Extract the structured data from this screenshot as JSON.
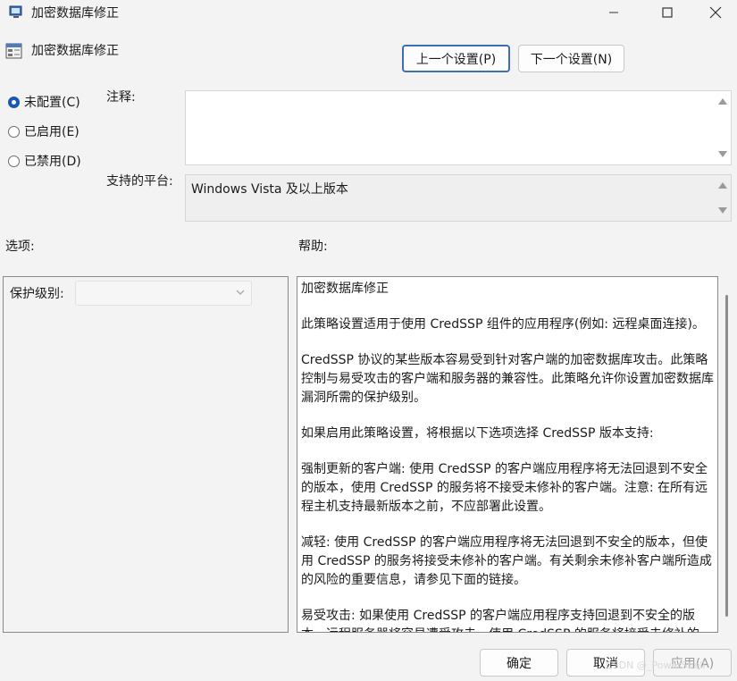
{
  "window": {
    "title": "加密数据库修正",
    "controls": {
      "minimize": "—",
      "maximize": "☐",
      "close": "✕"
    }
  },
  "header": {
    "policy_title": "加密数据库修正",
    "prev_label": "上一个设置(P)",
    "next_label": "下一个设置(N)"
  },
  "state": {
    "options": [
      {
        "label": "未配置(C)",
        "checked": true
      },
      {
        "label": "已启用(E)",
        "checked": false
      },
      {
        "label": "已禁用(D)",
        "checked": false
      }
    ]
  },
  "comment": {
    "label": "注释:",
    "value": ""
  },
  "platform": {
    "label": "支持的平台:",
    "value": "Windows Vista 及以上版本"
  },
  "options_section": {
    "label": "选项:",
    "protection_label": "保护级别:",
    "protection_value": ""
  },
  "help_section": {
    "label": "帮助:",
    "paragraphs": [
      "加密数据库修正",
      "此策略设置适用于使用 CredSSP 组件的应用程序(例如: 远程桌面连接)。",
      "CredSSP 协议的某些版本容易受到针对客户端的加密数据库攻击。此策略控制与易受攻击的客户端和服务器的兼容性。此策略允许你设置加密数据库漏洞所需的保护级别。",
      "如果启用此策略设置，将根据以下选项选择 CredSSP 版本支持:",
      "强制更新的客户端: 使用 CredSSP 的客户端应用程序将无法回退到不安全的版本，使用 CredSSP 的服务将不接受未修补的客户端。注意: 在所有远程主机支持最新版本之前，不应部署此设置。",
      "减轻: 使用 CredSSP 的客户端应用程序将无法回退到不安全的版本，但使用 CredSSP 的服务将接受未修补的客户端。有关剩余未修补客户端所造成的风险的重要信息，请参见下面的链接。",
      "易受攻击: 如果使用 CredSSP 的客户端应用程序支持回退到不安全的版本，远程服务器将容易遭受攻击。使用 CredSSP 的服务将接受未修补的"
    ]
  },
  "footer": {
    "ok_label": "确定",
    "cancel_label": "取消",
    "apply_label": "应用(A)"
  },
  "watermark": "CSDN @_PowerShell",
  "colors": {
    "accent": "#1a57b5",
    "background": "#f3f3f3"
  }
}
